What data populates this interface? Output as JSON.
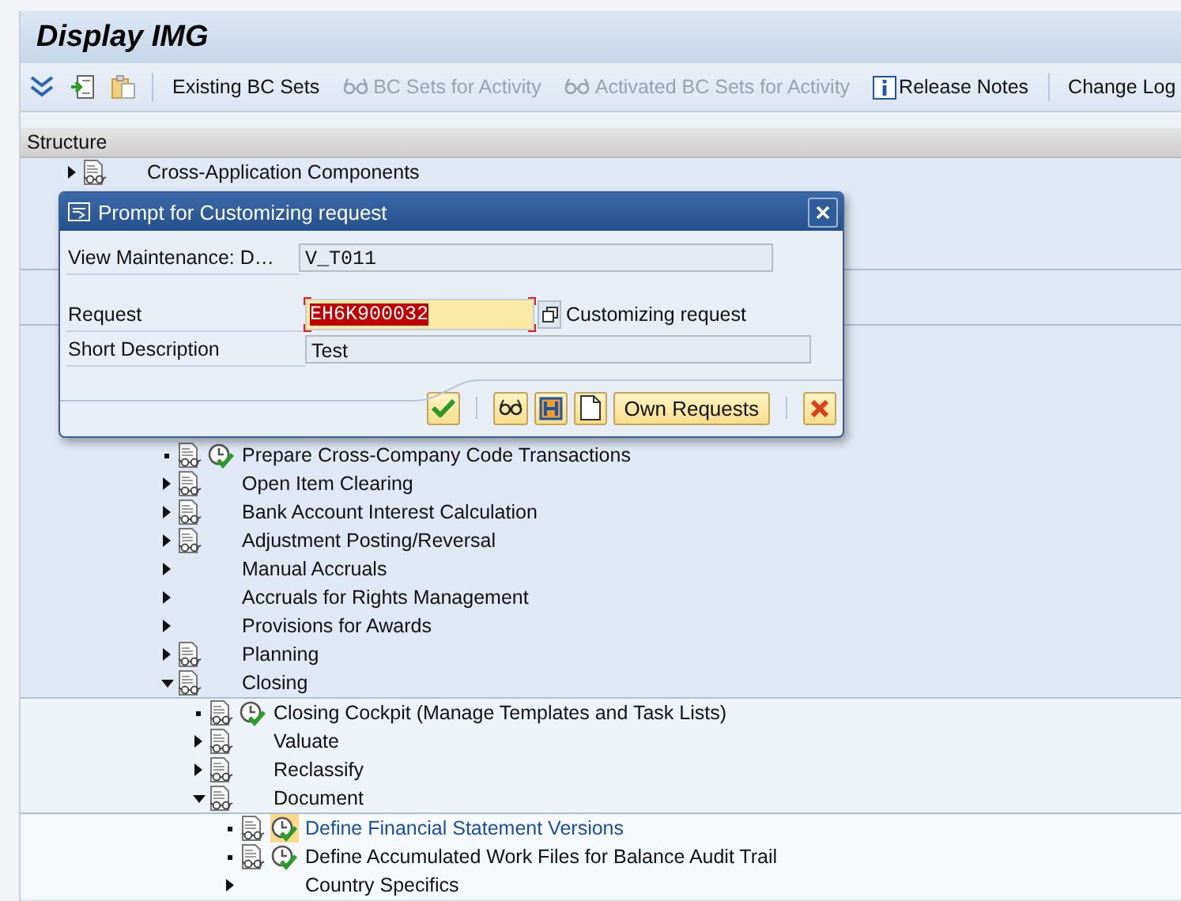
{
  "window": {
    "title": "Display IMG"
  },
  "toolbar": [
    {
      "kind": "text",
      "label": "Existing BC Sets",
      "disabled": false
    },
    {
      "kind": "bcset",
      "label": "BC Sets for Activity",
      "disabled": true
    },
    {
      "kind": "bcset",
      "label": "Activated BC Sets for Activity",
      "disabled": true
    },
    {
      "kind": "info",
      "label": "Release Notes",
      "disabled": false
    },
    {
      "kind": "separator_text",
      "label": "Change Log",
      "disabled": false
    }
  ],
  "tree": {
    "header": "Structure",
    "items": [
      {
        "label": "Cross-Application Components",
        "kind": "folder",
        "expanded": false,
        "document": true,
        "activity": false,
        "selected": false
      }
    ],
    "items_below_dialog": [
      {
        "label": "Prepare Cross-Company Code Transactions",
        "kind": "leaf",
        "expanded": false,
        "document": true,
        "activity": true,
        "selected": false
      },
      {
        "label": "Open Item Clearing",
        "kind": "folder",
        "expanded": false,
        "document": true,
        "activity": false,
        "selected": false
      },
      {
        "label": "Bank Account Interest Calculation",
        "kind": "folder",
        "expanded": false,
        "document": true,
        "activity": false,
        "selected": false
      },
      {
        "label": "Adjustment Posting/Reversal",
        "kind": "folder",
        "expanded": false,
        "document": true,
        "activity": false,
        "selected": false
      },
      {
        "label": "Manual Accruals",
        "kind": "folder",
        "expanded": false,
        "document": false,
        "activity": false,
        "selected": false
      },
      {
        "label": "Accruals for Rights Management",
        "kind": "folder",
        "expanded": false,
        "document": false,
        "activity": false,
        "selected": false
      },
      {
        "label": "Provisions for Awards",
        "kind": "folder",
        "expanded": false,
        "document": false,
        "activity": false,
        "selected": false
      },
      {
        "label": "Planning",
        "kind": "folder",
        "expanded": false,
        "document": true,
        "activity": false,
        "selected": false
      },
      {
        "label": "Closing",
        "kind": "folder",
        "expanded": true,
        "document": true,
        "activity": false,
        "selected": false,
        "children": [
          {
            "label": "Closing Cockpit (Manage Templates and Task Lists)",
            "kind": "leaf",
            "expanded": false,
            "document": true,
            "activity": true,
            "selected": false
          },
          {
            "label": "Valuate",
            "kind": "folder",
            "expanded": false,
            "document": true,
            "activity": false,
            "selected": false
          },
          {
            "label": "Reclassify",
            "kind": "folder",
            "expanded": false,
            "document": true,
            "activity": false,
            "selected": false
          },
          {
            "label": "Document",
            "kind": "folder",
            "expanded": true,
            "document": true,
            "activity": false,
            "selected": false,
            "children": [
              {
                "label": "Define Financial Statement Versions",
                "kind": "leaf",
                "expanded": false,
                "document": true,
                "activity": true,
                "selected": true
              },
              {
                "label": "Define Accumulated Work Files for Balance Audit Trail",
                "kind": "leaf",
                "expanded": false,
                "document": true,
                "activity": true,
                "selected": false
              },
              {
                "label": "Country Specifics",
                "kind": "folder",
                "expanded": false,
                "document": false,
                "activity": false,
                "selected": false
              }
            ]
          }
        ]
      }
    ]
  },
  "dialog": {
    "title": "Prompt for Customizing request",
    "fields": [
      {
        "kind": "readonly",
        "label": "View Maintenance: D…",
        "value": "V_T011"
      },
      {
        "kind": "input",
        "label": "Request",
        "value": "EH6K900032",
        "help": "Customizing request"
      },
      {
        "kind": "readonly",
        "label": "Short Description",
        "value": "Test"
      }
    ],
    "buttons": [
      {
        "kind": "confirm"
      },
      {
        "kind": "glasses"
      },
      {
        "kind": "transport"
      },
      {
        "kind": "new"
      },
      {
        "kind": "text",
        "label": "Own Requests"
      },
      {
        "kind": "cancel"
      }
    ]
  }
}
